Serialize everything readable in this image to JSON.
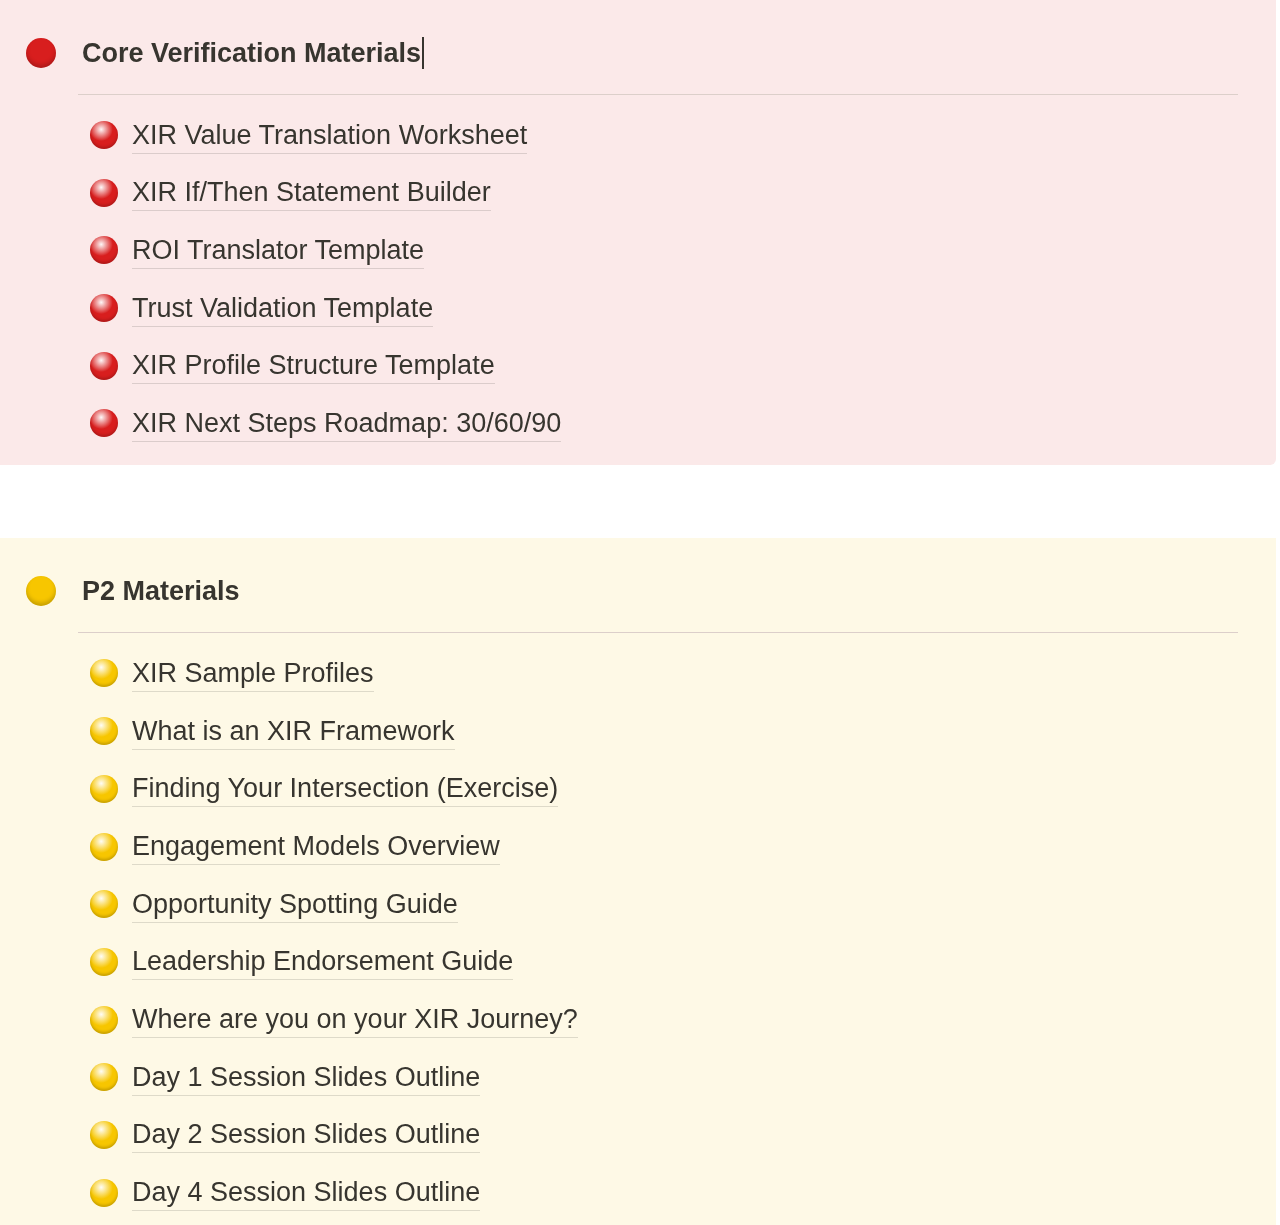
{
  "sections": [
    {
      "title": "Core Verification Materials",
      "color": "#d81e1e",
      "cursor": true,
      "items": [
        "XIR Value Translation Worksheet",
        "XIR If/Then Statement Builder",
        "ROI Translator Template",
        "Trust Validation Template",
        "XIR Profile Structure Template",
        "XIR Next Steps Roadmap: 30/60/90"
      ]
    },
    {
      "title": "P2 Materials",
      "color": "#f7c600",
      "cursor": false,
      "items": [
        "XIR Sample Profiles",
        "What is an XIR Framework",
        "Finding Your Intersection (Exercise)",
        "Engagement Models Overview",
        "Opportunity Spotting Guide",
        "Leadership Endorsement Guide",
        "Where are you on your XIR Journey?",
        "Day 1 Session Slides Outline",
        "Day 2 Session Slides Outline",
        "Day 4 Session Slides Outline"
      ]
    }
  ]
}
